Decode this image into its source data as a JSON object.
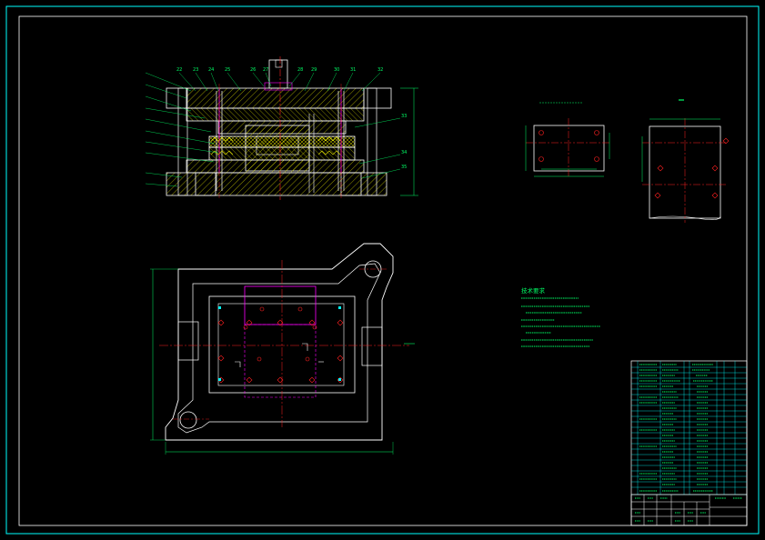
{
  "section_view": {
    "balloons": [
      "22",
      "23",
      "24",
      "25",
      "26",
      "27",
      "28",
      "29",
      "30",
      "31",
      "32",
      "33",
      "34",
      "35"
    ]
  },
  "note_view": {
    "title": "技术要求"
  },
  "colors": {
    "background": "#000000",
    "outline": "#ffffff",
    "hatch": "#d8d800",
    "centerline": "#ff2020",
    "magenta": "#ff00ff",
    "leader": "#00ff66",
    "dimension": "#00ff66",
    "frame": "#00ffff"
  }
}
